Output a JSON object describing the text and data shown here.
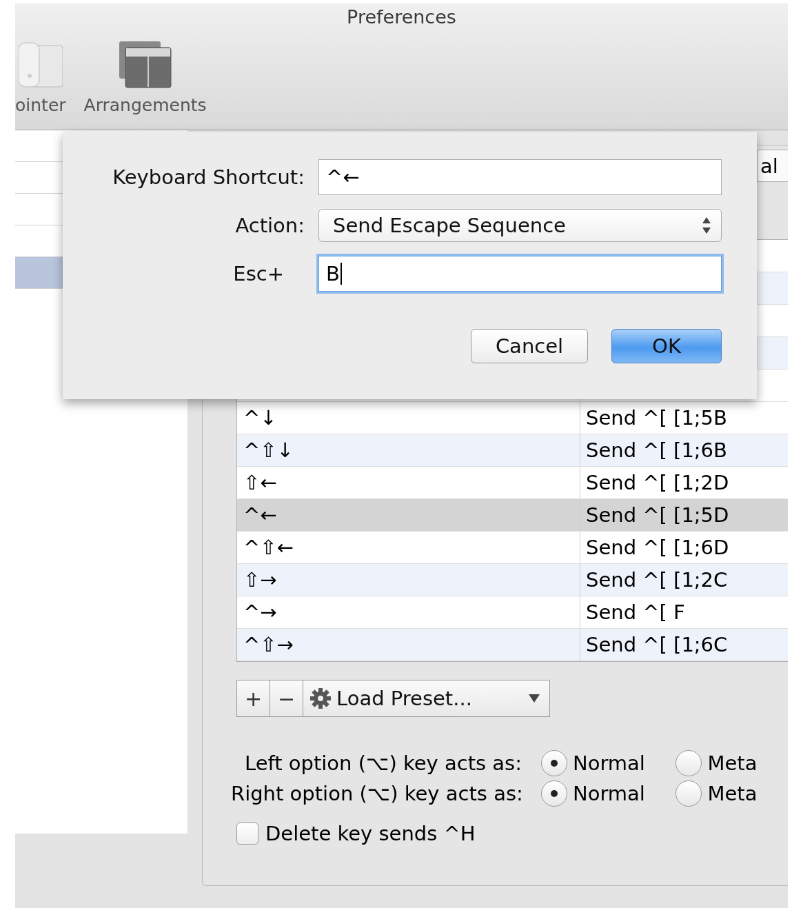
{
  "window": {
    "title": "Preferences"
  },
  "toolbar": [
    {
      "label": "ointer",
      "kind": "pointer"
    },
    {
      "label": "Arrangements",
      "kind": "arrangements"
    }
  ],
  "sidebar": {
    "rows": [
      {
        "selected": false
      },
      {
        "selected": false
      },
      {
        "selected": false
      },
      {
        "selected": false
      },
      {
        "selected": true
      }
    ]
  },
  "tab_fragment": "al",
  "key_mappings": {
    "rows": [
      {
        "key": "^↓",
        "action": "Send ^[ [1;5B",
        "selected": false
      },
      {
        "key": "^⇧↓",
        "action": "Send ^[ [1;6B",
        "selected": false
      },
      {
        "key": "⇧←",
        "action": "Send ^[ [1;2D",
        "selected": false
      },
      {
        "key": "^←",
        "action": "Send ^[ [1;5D",
        "selected": true
      },
      {
        "key": "^⇧←",
        "action": "Send ^[ [1;6D",
        "selected": false
      },
      {
        "key": "⇧→",
        "action": "Send ^[ [1;2C",
        "selected": false
      },
      {
        "key": "^→",
        "action": "Send ^[ F",
        "selected": false
      },
      {
        "key": "^⇧→",
        "action": "Send ^[ [1;6C",
        "selected": false
      }
    ]
  },
  "list_buttons": [
    "+",
    "−"
  ],
  "preset_menu": {
    "label": "Load Preset..."
  },
  "option_keys": [
    {
      "label": "Left option (⌥) key acts as:",
      "options": [
        {
          "label": "Normal",
          "selected": true
        },
        {
          "label": "Meta",
          "selected": false
        }
      ]
    },
    {
      "label": "Right option (⌥) key acts as:",
      "options": [
        {
          "label": "Normal",
          "selected": true
        },
        {
          "label": "Meta",
          "selected": false
        }
      ]
    }
  ],
  "delete_key": {
    "label": "Delete key sends ^H",
    "checked": false
  },
  "dialog": {
    "shortcut": {
      "label": "Keyboard Shortcut:",
      "value": "^←"
    },
    "action": {
      "label": "Action:",
      "value": "Send Escape Sequence"
    },
    "escape": {
      "label": "Esc+",
      "value": "B",
      "focused": true
    },
    "buttons": [
      {
        "label": "Cancel",
        "default": false
      },
      {
        "label": "OK",
        "default": true
      }
    ]
  }
}
